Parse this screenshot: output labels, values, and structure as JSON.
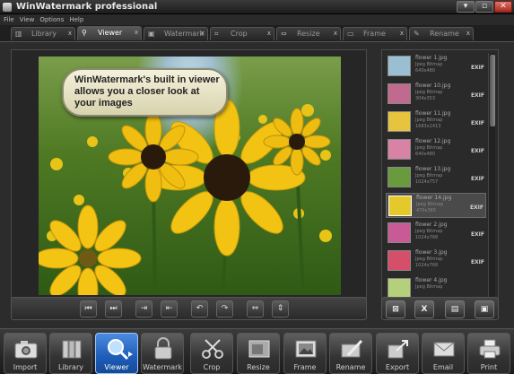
{
  "window": {
    "title": "WinWatermark professional",
    "minimize": "▾",
    "restore": "▫",
    "close": "✕"
  },
  "menu": [
    "File",
    "View",
    "Options",
    "Help"
  ],
  "tabs": [
    {
      "label": "Library",
      "icon": "library-icon",
      "active": false
    },
    {
      "label": "Viewer",
      "icon": "magnifier-icon",
      "active": true
    },
    {
      "label": "Watermark",
      "icon": "lock-icon",
      "active": false
    },
    {
      "label": "Crop",
      "icon": "crop-icon",
      "active": false
    },
    {
      "label": "Resize",
      "icon": "resize-icon",
      "active": false
    },
    {
      "label": "Frame",
      "icon": "frame-icon",
      "active": false
    },
    {
      "label": "Rename",
      "icon": "pen-icon",
      "active": false
    }
  ],
  "viewer": {
    "callout": "WinWatermark's built in viewer allows you a closer look at your images"
  },
  "thumbnails": [
    {
      "name": "flower 1.jpg",
      "type": "Jpeg Bitmap",
      "size": "640x480",
      "exif": "EXIF",
      "color": "#9bbfd2"
    },
    {
      "name": "flower 10.jpg",
      "type": "Jpeg Bitmap",
      "size": "304x353",
      "exif": "EXIF",
      "color": "#c06a8f"
    },
    {
      "name": "flower 11.jpg",
      "type": "Jpeg Bitmap",
      "size": "1683x1413",
      "exif": "EXIF",
      "color": "#e6c43e"
    },
    {
      "name": "flower 12.jpg",
      "type": "Jpeg Bitmap",
      "size": "640x480",
      "exif": "EXIF",
      "color": "#d882a6"
    },
    {
      "name": "flower 13.jpg",
      "type": "Jpeg Bitmap",
      "size": "1024x757",
      "exif": "EXIF",
      "color": "#6a9a3e"
    },
    {
      "name": "flower 14.jpg",
      "type": "Jpeg Bitmap",
      "size": "470x365",
      "exif": "EXIF",
      "color": "#e5c82a",
      "active": true
    },
    {
      "name": "flower 2.jpg",
      "type": "Jpeg Bitmap",
      "size": "1024x768",
      "exif": "EXIF",
      "color": "#c85a95"
    },
    {
      "name": "flower 3.jpg",
      "type": "Jpeg Bitmap",
      "size": "1024x768",
      "exif": "EXIF",
      "color": "#d64f6a"
    },
    {
      "name": "flower 4.jpg",
      "type": "Jpeg Bitmap",
      "size": "",
      "exif": "",
      "color": "#b4d07a"
    }
  ],
  "nav_buttons": [
    {
      "name": "first-image-button",
      "glyph": "⏮"
    },
    {
      "name": "next-image-button",
      "glyph": "⏭"
    },
    {
      "name": "fit-width-button",
      "glyph": "⇥"
    },
    {
      "name": "fit-page-button",
      "glyph": "⇤"
    },
    {
      "name": "rotate-left-button",
      "glyph": "↶"
    },
    {
      "name": "rotate-right-button",
      "glyph": "↷"
    },
    {
      "name": "flip-horizontal-button",
      "glyph": "⇔"
    },
    {
      "name": "flip-vertical-button",
      "glyph": "⇕"
    }
  ],
  "action_buttons": [
    {
      "name": "remove-all-button",
      "glyph": "⊠"
    },
    {
      "name": "remove-button",
      "glyph": "X"
    },
    {
      "name": "open-folder-button",
      "glyph": "▤"
    },
    {
      "name": "save-button",
      "glyph": "▣"
    }
  ],
  "toolbar": [
    {
      "label": "Import",
      "icon": "camera-icon"
    },
    {
      "label": "Library",
      "icon": "library-icon"
    },
    {
      "label": "Viewer",
      "icon": "magnifier-icon",
      "active": true
    },
    {
      "label": "Watermark",
      "icon": "lock-icon"
    },
    {
      "label": "Crop",
      "icon": "crop-icon"
    },
    {
      "label": "Resize",
      "icon": "resize-icon"
    },
    {
      "label": "Frame",
      "icon": "frame-icon"
    },
    {
      "label": "Rename",
      "icon": "pen-icon"
    },
    {
      "label": "Export",
      "icon": "export-icon"
    },
    {
      "label": "Email",
      "icon": "envelope-icon"
    },
    {
      "label": "Print",
      "icon": "printer-icon"
    }
  ]
}
